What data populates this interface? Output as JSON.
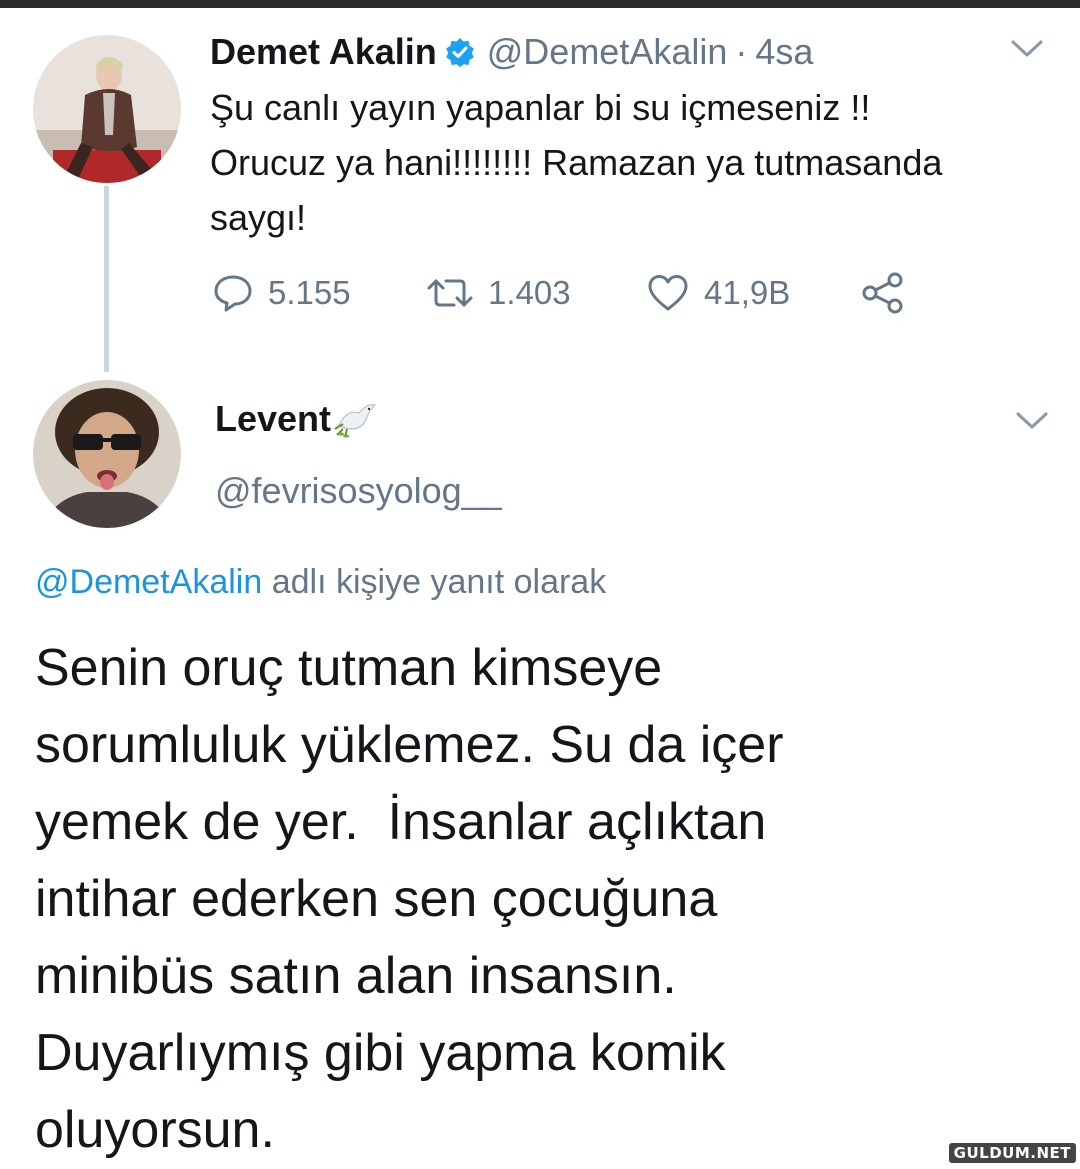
{
  "original_tweet": {
    "name": "Demet Akalin",
    "handle": "@DemetAkalin",
    "separator": "·",
    "time": "4sa",
    "text_lines": [
      "Şu canlı yayın yapanlar bi su içmeseniz !!",
      "Orucuz ya hani!!!!!!!! Ramazan ya tutmasanda",
      "saygı!"
    ],
    "replies": "5.155",
    "retweets": "1.403",
    "likes": "41,9B",
    "icons": {
      "verified": "verified-badge-icon",
      "menu": "chevron-down-icon",
      "reply": "reply-icon",
      "retweet": "retweet-icon",
      "like": "heart-icon",
      "share": "share-icon"
    }
  },
  "reply_tweet": {
    "name": "Levent",
    "name_emoji": "dove-icon",
    "handle": "@fevrisosyolog__",
    "replying_to_mention": "@DemetAkalin",
    "replying_to_suffix": "adlı kişiye yanıt olarak",
    "text_lines": [
      "Senin oruç tutman kimseye",
      "sorumluluk yüklemez. Su da içer",
      "yemek de yer.  İnsanlar açlıktan",
      "intihar ederken sen çocuğuna",
      "minibüs satın alan insansın.",
      "Duyarlıymış gibi yapma komik",
      "oluyorsun."
    ]
  },
  "colors": {
    "text": "#14171a",
    "secondary": "#657786",
    "accent": "#1b95e0",
    "thread_line": "#ccd6dd"
  },
  "watermark": "GULDUM.NET"
}
